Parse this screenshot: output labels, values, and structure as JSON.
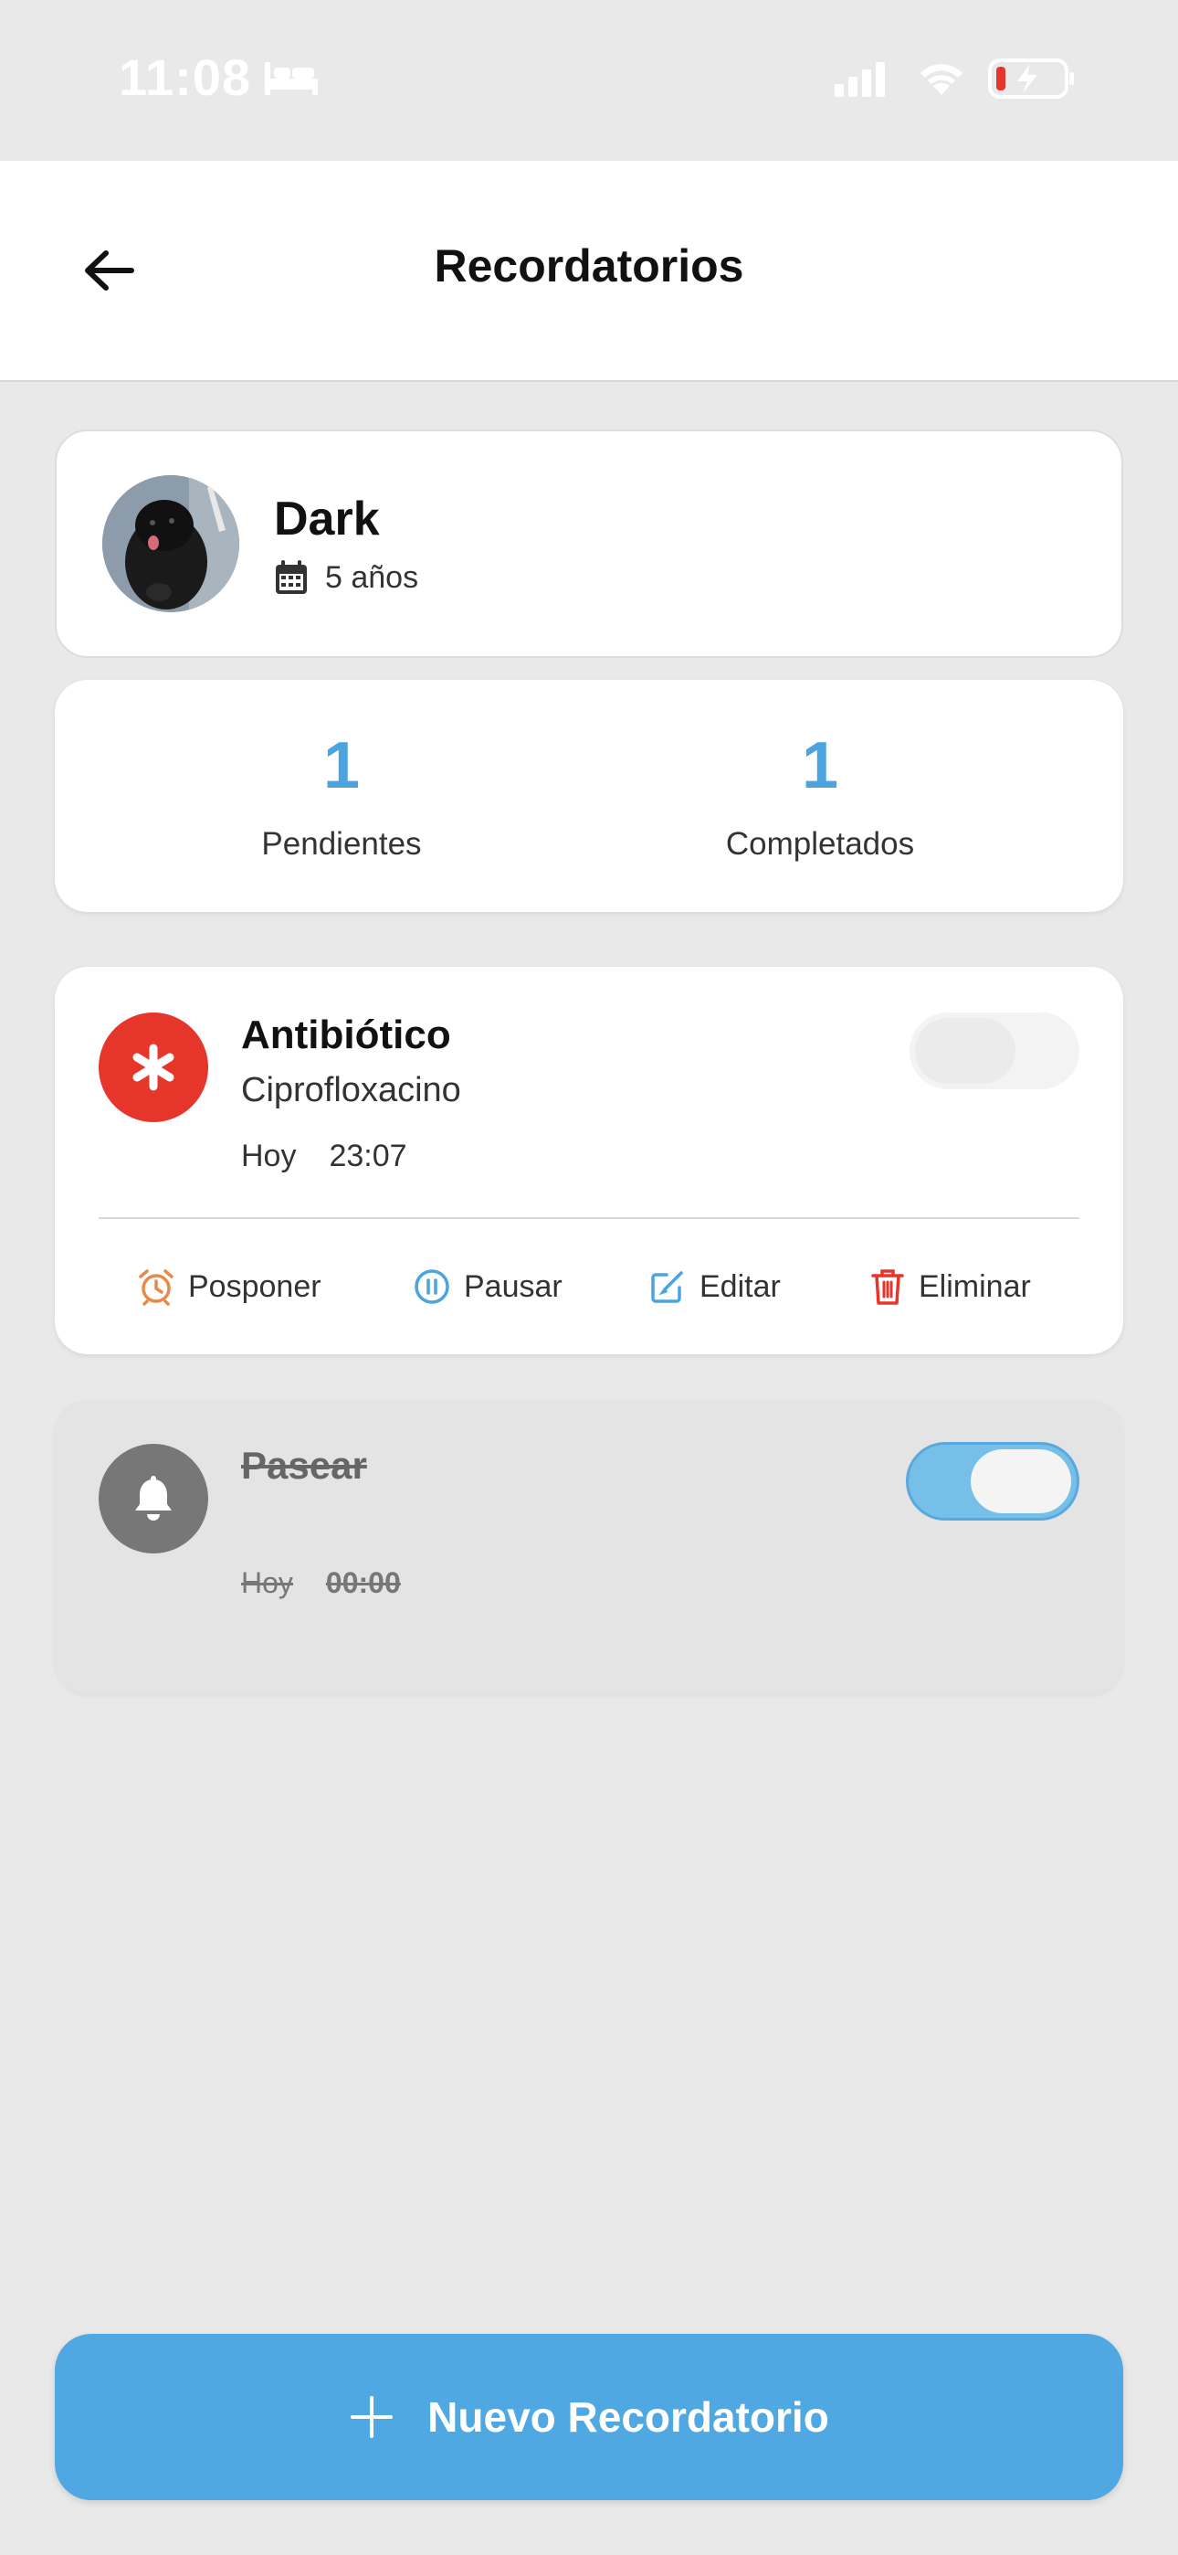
{
  "status_bar": {
    "time": "11:08"
  },
  "header": {
    "title": "Recordatorios"
  },
  "pet": {
    "name": "Dark",
    "age": "5 años"
  },
  "stats": {
    "pending_count": "1",
    "pending_label": "Pendientes",
    "completed_count": "1",
    "completed_label": "Completados"
  },
  "reminders": [
    {
      "title": "Antibiótico",
      "subtitle": "Ciprofloxacino",
      "day": "Hoy",
      "time": "23:07",
      "icon": "asterisk-icon",
      "icon_color": "#e6352b",
      "enabled": false,
      "actions": {
        "postpone": "Posponer",
        "pause": "Pausar",
        "edit": "Editar",
        "delete": "Eliminar"
      }
    },
    {
      "title": "Pasear",
      "day": "Hoy",
      "time": "00:00",
      "icon": "bell-icon",
      "icon_color": "#777778",
      "enabled": true,
      "completed": true
    }
  ],
  "new_button": {
    "label": "Nuevo Recordatorio"
  },
  "colors": {
    "accent": "#4fa8e2",
    "stat_number": "#4ba3e0",
    "danger": "#e6352b",
    "postpone": "#e8894a"
  }
}
